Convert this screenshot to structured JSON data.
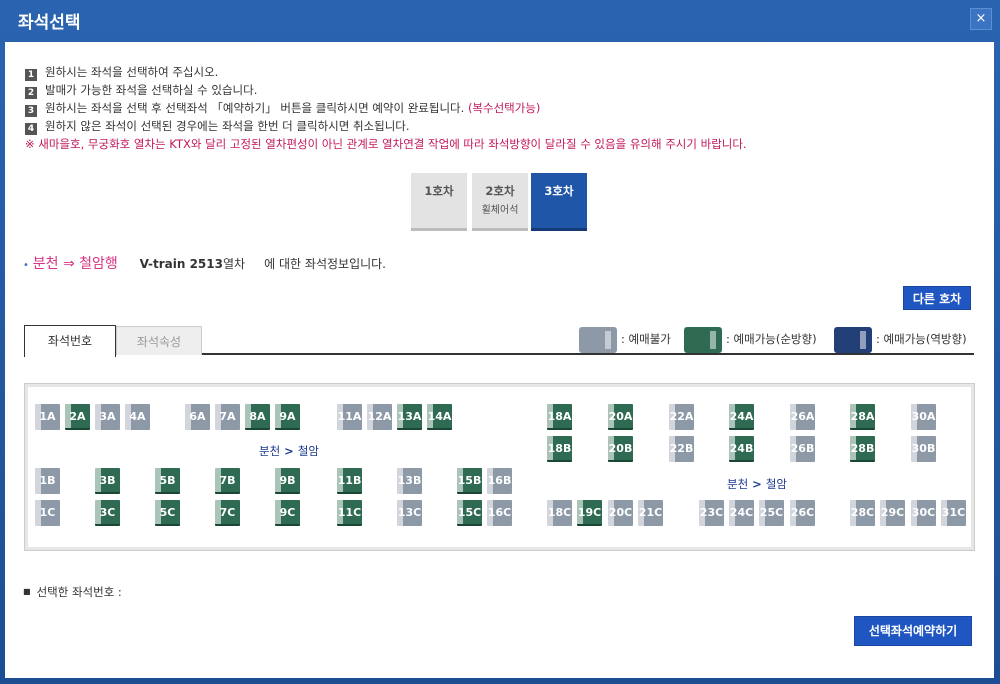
{
  "window": {
    "title": "좌석선택",
    "close_label": "×"
  },
  "instructions": [
    {
      "num": "1",
      "text": "원하시는 좌석을 선택하여 주십시오.",
      "extra": ""
    },
    {
      "num": "2",
      "text": "발매가 가능한 좌석을 선택하실 수 있습니다.",
      "extra": ""
    },
    {
      "num": "3",
      "text": "원하시는 좌석을 선택 후 선택좌석 「예약하기」 버튼을 클릭하시면 예약이 완료됩니다.",
      "extra": "(복수선택가능)"
    },
    {
      "num": "4",
      "text": "원하지 않은 좌석이 선택된 경우에는 좌석을 한번 더 클릭하시면 취소됩니다.",
      "extra": ""
    }
  ],
  "warning": "※ 새마을호, 무궁화호 열차는 KTX와 달리 고정된 열차편성이 아닌 관계로 열차연결 작업에 따라 좌석방향이 달라질 수 있음을 유의해 주시기 바랍니다.",
  "cars": [
    {
      "label": "1호차",
      "sub": "",
      "active": false
    },
    {
      "label": "2호차",
      "sub": "휠체어석",
      "active": false
    },
    {
      "label": "3호차",
      "sub": "",
      "active": true
    }
  ],
  "route": {
    "bullet": "•",
    "stations": "분천 ⇒ 철암행",
    "train": "V-train 2513",
    "train_suffix": "열차",
    "info": "에 대한 좌석정보입니다."
  },
  "other_car_button": "다른 호차",
  "tabs": {
    "seat_number": "좌석번호",
    "seat_attr": "좌석속성"
  },
  "legend": {
    "unavailable": ": 예매불가",
    "forward": ": 예매가능(순방향)",
    "reverse": ": 예매가능(역방향)",
    "colors": {
      "unavailable": "#8e99a8",
      "forward": "#2f6b52",
      "reverse": "#233f78"
    }
  },
  "direction_label": {
    "from": "분천",
    "arrow": " > ",
    "to": "철암"
  },
  "seats": {
    "row_a_left": [
      {
        "id": "1A",
        "state": "unavailable"
      },
      {
        "id": "2A",
        "state": "forward"
      },
      {
        "id": "3A",
        "state": "unavailable"
      },
      {
        "id": "4A",
        "state": "unavailable"
      },
      {
        "id": "6A",
        "state": "unavailable"
      },
      {
        "id": "7A",
        "state": "unavailable"
      },
      {
        "id": "8A",
        "state": "forward"
      },
      {
        "id": "9A",
        "state": "forward"
      },
      {
        "id": "11A",
        "state": "unavailable"
      },
      {
        "id": "12A",
        "state": "unavailable"
      },
      {
        "id": "13A",
        "state": "forward"
      },
      {
        "id": "14A",
        "state": "forward"
      }
    ],
    "row_a_right": [
      {
        "id": "18A",
        "state": "forward"
      },
      {
        "id": "20A",
        "state": "forward"
      },
      {
        "id": "22A",
        "state": "unavailable"
      },
      {
        "id": "24A",
        "state": "forward"
      },
      {
        "id": "26A",
        "state": "unavailable"
      },
      {
        "id": "28A",
        "state": "forward"
      },
      {
        "id": "30A",
        "state": "unavailable"
      }
    ],
    "row_b_right": [
      {
        "id": "18B",
        "state": "forward"
      },
      {
        "id": "20B",
        "state": "forward"
      },
      {
        "id": "22B",
        "state": "unavailable"
      },
      {
        "id": "24B",
        "state": "forward"
      },
      {
        "id": "26B",
        "state": "unavailable"
      },
      {
        "id": "28B",
        "state": "forward"
      },
      {
        "id": "30B",
        "state": "unavailable"
      }
    ],
    "row_b_left": [
      {
        "id": "1B",
        "state": "unavailable"
      },
      {
        "id": "3B",
        "state": "forward"
      },
      {
        "id": "5B",
        "state": "forward"
      },
      {
        "id": "7B",
        "state": "forward"
      },
      {
        "id": "9B",
        "state": "forward"
      },
      {
        "id": "11B",
        "state": "forward"
      },
      {
        "id": "13B",
        "state": "unavailable"
      },
      {
        "id": "15B",
        "state": "forward"
      },
      {
        "id": "16B",
        "state": "unavailable"
      }
    ],
    "row_c_left": [
      {
        "id": "1C",
        "state": "unavailable"
      },
      {
        "id": "3C",
        "state": "forward"
      },
      {
        "id": "5C",
        "state": "forward"
      },
      {
        "id": "7C",
        "state": "forward"
      },
      {
        "id": "9C",
        "state": "forward"
      },
      {
        "id": "11C",
        "state": "forward"
      },
      {
        "id": "13C",
        "state": "unavailable"
      },
      {
        "id": "15C",
        "state": "forward"
      },
      {
        "id": "16C",
        "state": "unavailable"
      }
    ],
    "row_c_right": [
      {
        "id": "18C",
        "state": "unavailable"
      },
      {
        "id": "19C",
        "state": "forward"
      },
      {
        "id": "20C",
        "state": "unavailable"
      },
      {
        "id": "21C",
        "state": "unavailable"
      },
      {
        "id": "23C",
        "state": "unavailable"
      },
      {
        "id": "24C",
        "state": "unavailable"
      },
      {
        "id": "25C",
        "state": "unavailable"
      },
      {
        "id": "26C",
        "state": "unavailable"
      },
      {
        "id": "28C",
        "state": "unavailable"
      },
      {
        "id": "29C",
        "state": "unavailable"
      },
      {
        "id": "30C",
        "state": "unavailable"
      },
      {
        "id": "31C",
        "state": "unavailable"
      }
    ]
  },
  "selected_label": "선택한 좌석번호 :",
  "reserve_button": "선택좌석예약하기"
}
